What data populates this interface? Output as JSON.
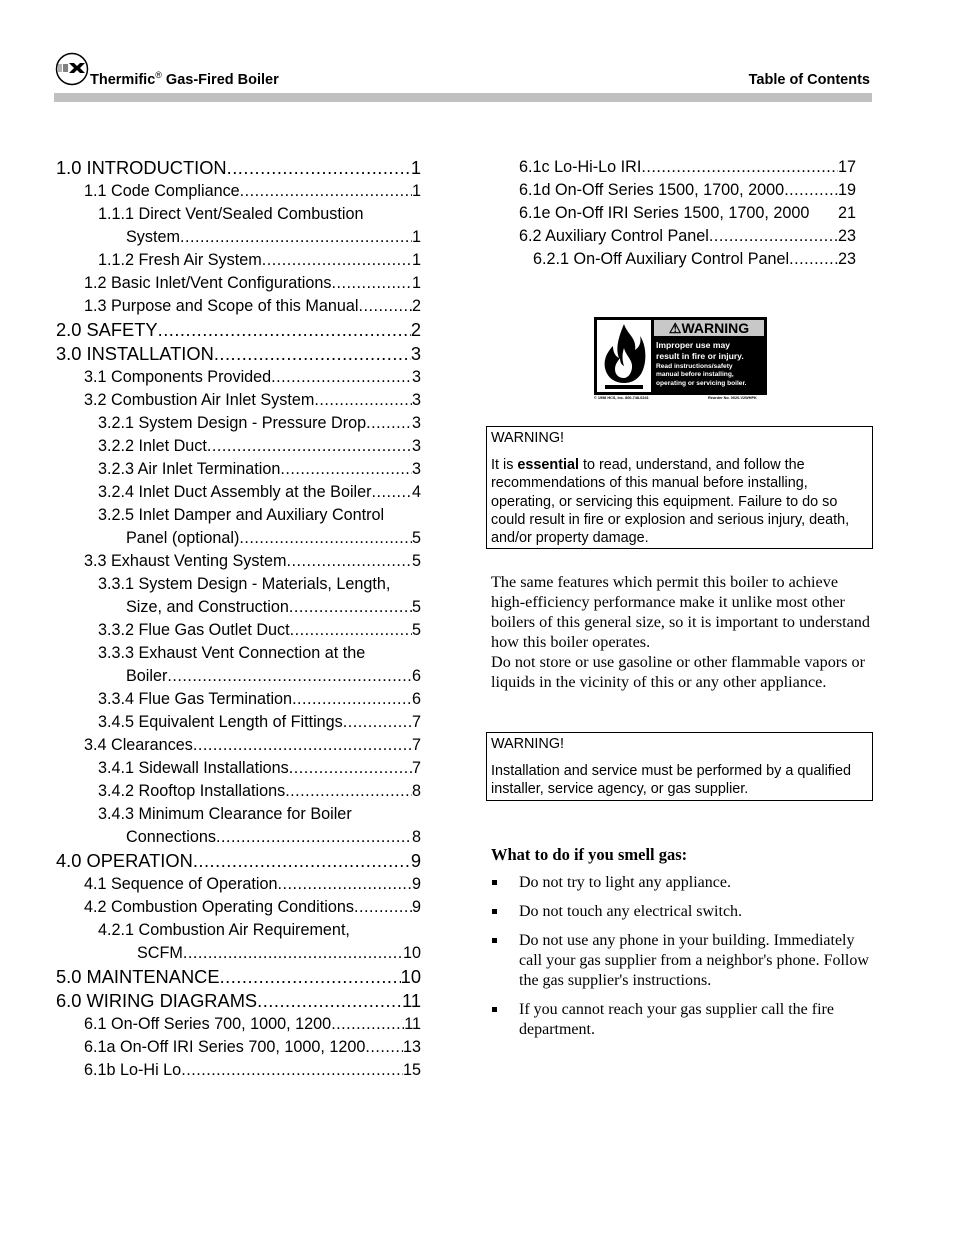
{
  "header": {
    "logo": "thermific-logo-icon",
    "brand": "Thermific",
    "brand_mark": "®",
    "product": " Gas-Fired Boiler",
    "section_title": "Table of Contents"
  },
  "toc_left": [
    {
      "level": 0,
      "lines": [
        "1.0 INTRODUCTION"
      ],
      "page": "1"
    },
    {
      "level": 1,
      "lines": [
        "1.1  Code Compliance"
      ],
      "page": "1"
    },
    {
      "level": 2,
      "lines": [
        "1.1.1  Direct Vent/Sealed Combustion",
        "System"
      ],
      "page": "1"
    },
    {
      "level": 2,
      "lines": [
        "1.1.2  Fresh Air System"
      ],
      "page": "1"
    },
    {
      "level": 1,
      "lines": [
        "1.2  Basic Inlet/Vent Configurations "
      ],
      "page": "1"
    },
    {
      "level": 1,
      "lines": [
        "1.3  Purpose and Scope of this Manual"
      ],
      "page": "2"
    },
    {
      "level": 0,
      "lines": [
        "2.0 SAFETY "
      ],
      "page": "2"
    },
    {
      "level": 0,
      "lines": [
        "3.0 INSTALLATION"
      ],
      "page": "3"
    },
    {
      "level": 1,
      "lines": [
        "3.1  Components Provided"
      ],
      "page": "3"
    },
    {
      "level": 1,
      "lines": [
        "3.2  Combustion Air Inlet System "
      ],
      "page": "3"
    },
    {
      "level": 2,
      "lines": [
        "3.2.1  System Design - Pressure Drop "
      ],
      "page": "3"
    },
    {
      "level": 2,
      "lines": [
        "3.2.2  Inlet Duct"
      ],
      "page": "3"
    },
    {
      "level": 2,
      "lines": [
        "3.2.3  Air Inlet Termination "
      ],
      "page": "3"
    },
    {
      "level": 2,
      "lines": [
        "3.2.4  Inlet Duct Assembly at the Boiler"
      ],
      "page": "4"
    },
    {
      "level": 2,
      "lines": [
        "3.2.5  Inlet Damper and Auxiliary Control",
        "Panel (optional) "
      ],
      "page": "5"
    },
    {
      "level": 1,
      "lines": [
        "3.3  Exhaust Venting System "
      ],
      "page": "5"
    },
    {
      "level": 2,
      "lines": [
        "3.3.1  System Design - Materials, Length,",
        "Size, and Construction "
      ],
      "page": "5"
    },
    {
      "level": 2,
      "lines": [
        "3.3.2  Flue Gas Outlet Duct"
      ],
      "page": "5"
    },
    {
      "level": 2,
      "lines": [
        "3.3.3  Exhaust Vent Connection at the",
        "Boiler"
      ],
      "page": "6"
    },
    {
      "level": 2,
      "lines": [
        "3.3.4  Flue Gas Termination"
      ],
      "page": "6"
    },
    {
      "level": 2,
      "lines": [
        "3.4.5  Equivalent Length of Fittings "
      ],
      "page": "7"
    },
    {
      "level": 1,
      "lines": [
        "3.4  Clearances"
      ],
      "page": "7"
    },
    {
      "level": 2,
      "lines": [
        "3.4.1  Sidewall Installations"
      ],
      "page": "7"
    },
    {
      "level": 2,
      "lines": [
        "3.4.2  Rooftop Installations"
      ],
      "page": "8"
    },
    {
      "level": 2,
      "lines": [
        "3.4.3  Minimum Clearance for Boiler",
        "Connections "
      ],
      "page": "8"
    },
    {
      "level": 0,
      "lines": [
        "4.0 OPERATION "
      ],
      "page": "9"
    },
    {
      "level": 1,
      "lines": [
        "4.1  Sequence of Operation "
      ],
      "page": "9"
    },
    {
      "level": 1,
      "lines": [
        "4.2  Combustion Operating Conditions"
      ],
      "page": "9"
    },
    {
      "level": 2,
      "lines": [
        "4.2.1  Combustion Air Requirement,",
        "SCFM"
      ],
      "page": "10",
      "wide_indent": true
    },
    {
      "level": 0,
      "lines": [
        "5.0 MAINTENANCE "
      ],
      "page": "10"
    },
    {
      "level": 0,
      "lines": [
        "6.0 WIRING DIAGRAMS"
      ],
      "page": "11"
    },
    {
      "level": 1,
      "lines": [
        "6.1  On-Off  Series 700, 1000, 1200"
      ],
      "page": "11"
    },
    {
      "level": 1,
      "lines": [
        "6.1a  On-Off IRI  Series 700, 1000, 1200 "
      ],
      "page": "13"
    },
    {
      "level": 1,
      "lines": [
        "6.1b  Lo-Hi Lo "
      ],
      "page": "15"
    }
  ],
  "toc_right": [
    {
      "level": 1,
      "lines": [
        "6.1c  Lo-Hi-Lo IRI "
      ],
      "page": " 17"
    },
    {
      "level": 1,
      "lines": [
        "6.1d On-Off  Series 1500, 1700, 2000 "
      ],
      "page": " 19"
    },
    {
      "level": 1,
      "lines": [
        "6.1e On-Off IRI  Series 1500, 1700, 2000 "
      ],
      "page": "21",
      "no_dots": true
    },
    {
      "level": 1,
      "lines": [
        "6.2  Auxiliary Control Panel"
      ],
      "page": " 23"
    },
    {
      "level": 2,
      "lines": [
        "6.2.1  On-Off Auxiliary Control Panel "
      ],
      "page": " 23"
    }
  ],
  "warning_label": {
    "icon": "flame-icon",
    "alert_icon": "warning-triangle-icon",
    "heading": "WARNING",
    "main_lines": [
      "Improper use may",
      "result in fire or injury."
    ],
    "sub_lines": [
      "Read instructions/safety",
      "manual before installing,",
      "operating or servicing boiler."
    ],
    "footer_left": "© 1998 HCS, Inc. 800-748-0241",
    "footer_right": "Reorder No. 0020-V2WHPK"
  },
  "warning_box_1": {
    "title": "WARNING!",
    "body_prefix": "It is ",
    "body_emphasis": "essential",
    "body_suffix": " to read, understand, and follow the recommendations of this manual before installing, operating, or servicing this equipment.  Failure to do so could result in fire or explosion and serious injury, death, and/or property damage."
  },
  "intro_paragraph": {
    "line_1": "The same features which permit this boiler to achieve high-efficiency performance make it unlike most other boilers of this general size, so it is important to understand how this boiler operates.",
    "line_2": "Do not store or use gasoline or other flammable vapors or liquids in the vicinity of this or any other appliance."
  },
  "warning_box_2": {
    "title": "WARNING!",
    "body": "Installation and service must be performed by a qualified installer, service agency, or gas supplier."
  },
  "gas_section": {
    "heading": "What to do if you smell gas:",
    "items": [
      "Do not try to light any appliance.",
      "Do not touch any electrical switch.",
      "Do not use any phone in your building. Immediately call your gas supplier from a neighbor's phone.  Follow the gas supplier's instructions.",
      "If you cannot reach your gas supplier call the fire department."
    ]
  }
}
